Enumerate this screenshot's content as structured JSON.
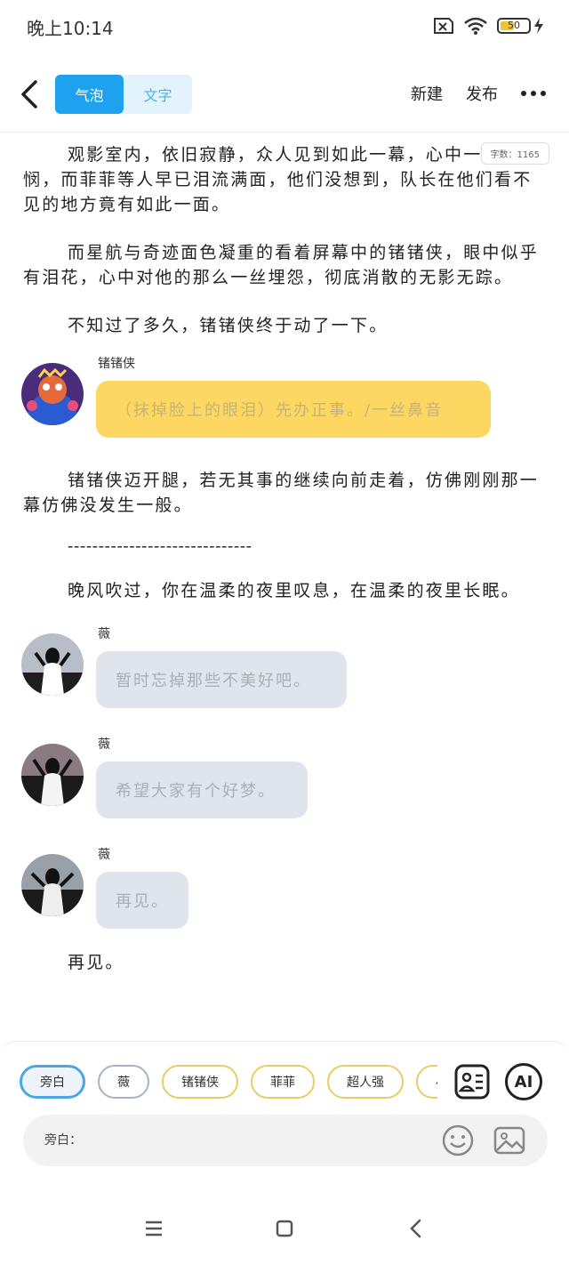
{
  "status": {
    "time": "晚上10:14",
    "battery": "50",
    "icons": [
      "sim-error-icon",
      "wifi-icon",
      "battery-icon",
      "charging-icon"
    ]
  },
  "topbar": {
    "tabs": [
      {
        "label": "气泡",
        "active": true
      },
      {
        "label": "文字",
        "active": false
      }
    ],
    "new_label": "新建",
    "publish_label": "发布"
  },
  "word_count": "字数：1165",
  "story": {
    "p1": "观影室内，依旧寂静，众人见到如此一幕，心中一丝怜悯，而菲菲等人早已泪流满面，他们没想到，队长在他们看不见的地方竟有如此一面。",
    "p2": "而星航与奇迹面色凝重的看着屏幕中的锗锗侠，眼中似乎有泪花，心中对他的那么一丝埋怨，彻底消散的无影无踪。",
    "p3": "不知过了多久，锗锗侠终于动了一下。",
    "bubble1": {
      "speaker": "锗锗侠",
      "text": "（抹掉脸上的眼泪）先办正事。/一丝鼻音"
    },
    "p4": "锗锗侠迈开腿，若无其事的继续向前走着，仿佛刚刚那一幕仿佛没发生一般。",
    "separator": "------------------------------",
    "p5": "晚风吹过，你在温柔的夜里叹息，在温柔的夜里长眠。",
    "bubble2": {
      "speaker": "薇",
      "text": "暂时忘掉那些不美好吧。"
    },
    "bubble3": {
      "speaker": "薇",
      "text": "希望大家有个好梦。"
    },
    "bubble4": {
      "speaker": "薇",
      "text": "再见。"
    },
    "p6": "再见。"
  },
  "bottom": {
    "chips": [
      {
        "label": "旁白",
        "selected": true
      },
      {
        "label": "薇",
        "selected": false
      },
      {
        "label": "锗锗侠",
        "selected": false
      },
      {
        "label": "菲菲",
        "selected": false
      },
      {
        "label": "超人强",
        "selected": false
      },
      {
        "label": "小",
        "selected": false
      }
    ],
    "ai_label": "AI",
    "input_label": "旁白：",
    "input_value": ""
  },
  "colors": {
    "accent": "#1ea1ef",
    "yellow_bubble": "#fcd862",
    "gray_bubble": "#e0e5ec"
  }
}
